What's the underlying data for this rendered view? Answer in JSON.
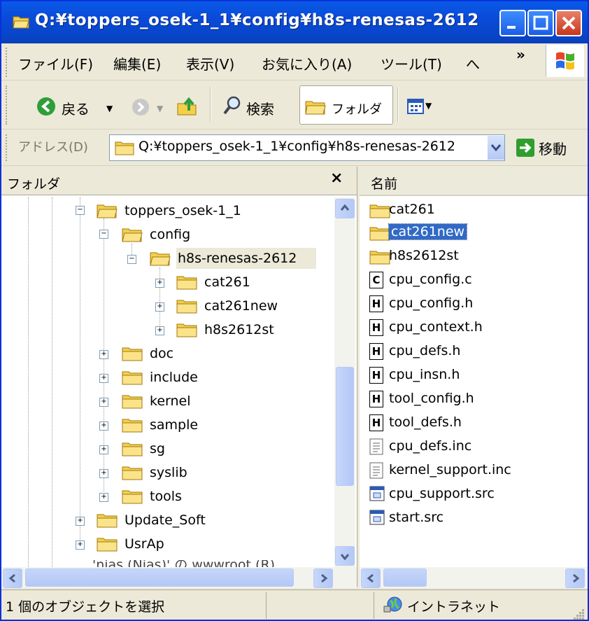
{
  "window": {
    "title": "Q:¥toppers_osek-1_1¥config¥h8s-renesas-2612"
  },
  "menu": {
    "items": [
      "ファイル(F)",
      "編集(E)",
      "表示(V)",
      "お気に入り(A)",
      "ツール(T)",
      "へ"
    ],
    "overflow": "»"
  },
  "toolbar": {
    "back": "戻る",
    "search": "検索",
    "folders": "フォルダ"
  },
  "address": {
    "label": "アドレス(D)",
    "value": "Q:¥toppers_osek-1_1¥config¥h8s-renesas-2612",
    "go": "移動"
  },
  "folder_pane": {
    "title": "フォルダ",
    "close": "×"
  },
  "tree": {
    "toppers": "toppers_osek-1_1",
    "config": "config",
    "h8s": "h8s-renesas-2612",
    "cat261": "cat261",
    "cat261new": "cat261new",
    "h8s2612st": "h8s2612st",
    "doc": "doc",
    "include": "include",
    "kernel": "kernel",
    "sample": "sample",
    "sg": "sg",
    "syslib": "syslib",
    "tools": "tools",
    "update_soft": "Update_Soft",
    "usrap": "UsrAp",
    "drive": "'nias (Nias)' の wwwroot (R)"
  },
  "file_list": {
    "column_name": "名前",
    "items": [
      {
        "name": "cat261",
        "icon": "folder-icon"
      },
      {
        "name": "cat261new",
        "icon": "folder-icon"
      },
      {
        "name": "h8s2612st",
        "icon": "folder-icon"
      },
      {
        "name": "cpu_config.c",
        "icon": "c-file-icon",
        "glyph": "C"
      },
      {
        "name": "cpu_config.h",
        "icon": "h-file-icon",
        "glyph": "H"
      },
      {
        "name": "cpu_context.h",
        "icon": "h-file-icon",
        "glyph": "H"
      },
      {
        "name": "cpu_defs.h",
        "icon": "h-file-icon",
        "glyph": "H"
      },
      {
        "name": "cpu_insn.h",
        "icon": "h-file-icon",
        "glyph": "H"
      },
      {
        "name": "tool_config.h",
        "icon": "h-file-icon",
        "glyph": "H"
      },
      {
        "name": "tool_defs.h",
        "icon": "h-file-icon",
        "glyph": "H"
      },
      {
        "name": "cpu_defs.inc",
        "icon": "text-file-icon"
      },
      {
        "name": "kernel_support.inc",
        "icon": "text-file-icon"
      },
      {
        "name": "cpu_support.src",
        "icon": "src-file-icon"
      },
      {
        "name": "start.src",
        "icon": "src-file-icon"
      }
    ]
  },
  "status": {
    "selection": "1 個のオブジェクトを選択",
    "zone": "イントラネット"
  },
  "colors": {
    "titlebar": "#0a4ad8",
    "selection": "#316ac5",
    "folder": "#f5cf4a"
  }
}
